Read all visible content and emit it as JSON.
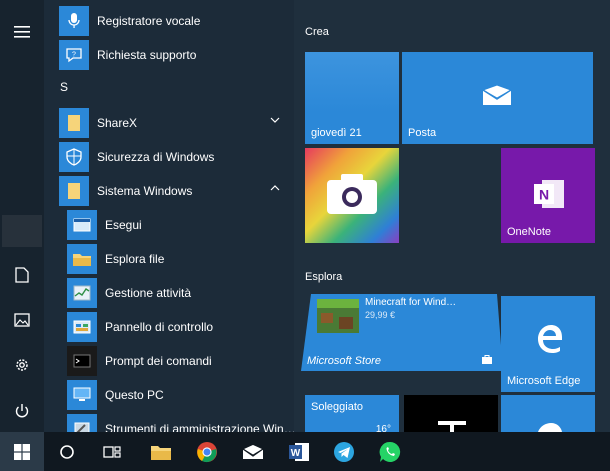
{
  "apps": [
    {
      "label": "Registratore vocale",
      "icon": "microphone-icon"
    },
    {
      "label": "Richiesta supporto",
      "icon": "support-icon"
    },
    {
      "letter": "S"
    },
    {
      "label": "ShareX",
      "icon": "folder-icon",
      "expand": "chevron-down-icon"
    },
    {
      "label": "Sicurezza di Windows",
      "icon": "shield-icon"
    },
    {
      "label": "Sistema Windows",
      "icon": "folder-icon",
      "expand": "chevron-up-icon"
    },
    {
      "label": "Esegui",
      "icon": "run-icon"
    },
    {
      "label": "Esplora file",
      "icon": "folder-icon"
    },
    {
      "label": "Gestione attività",
      "icon": "task-manager-icon"
    },
    {
      "label": "Pannello di controllo",
      "icon": "control-panel-icon"
    },
    {
      "label": "Prompt dei comandi",
      "icon": "cmd-icon"
    },
    {
      "label": "Questo PC",
      "icon": "pc-icon"
    },
    {
      "label": "Strumenti di amministrazione Win…",
      "icon": "admin-tools-icon"
    }
  ],
  "tiles": {
    "group1": "Crea",
    "calendar": {
      "label": "giovedì 21"
    },
    "mail": {
      "label": "Posta"
    },
    "onenote": {
      "label": "OneNote"
    },
    "group2": "Esplora",
    "store": {
      "label": "Microsoft Store",
      "game_title": "Minecraft for Wind…",
      "price": "29,99 €"
    },
    "edge": {
      "label": "Microsoft Edge"
    },
    "weather": {
      "label": "Soleggiato",
      "temp": "16°"
    }
  },
  "colors": {
    "accent": "#2b88d8",
    "onenote": "#7719aa",
    "tile_blue": "#2b88d8"
  }
}
